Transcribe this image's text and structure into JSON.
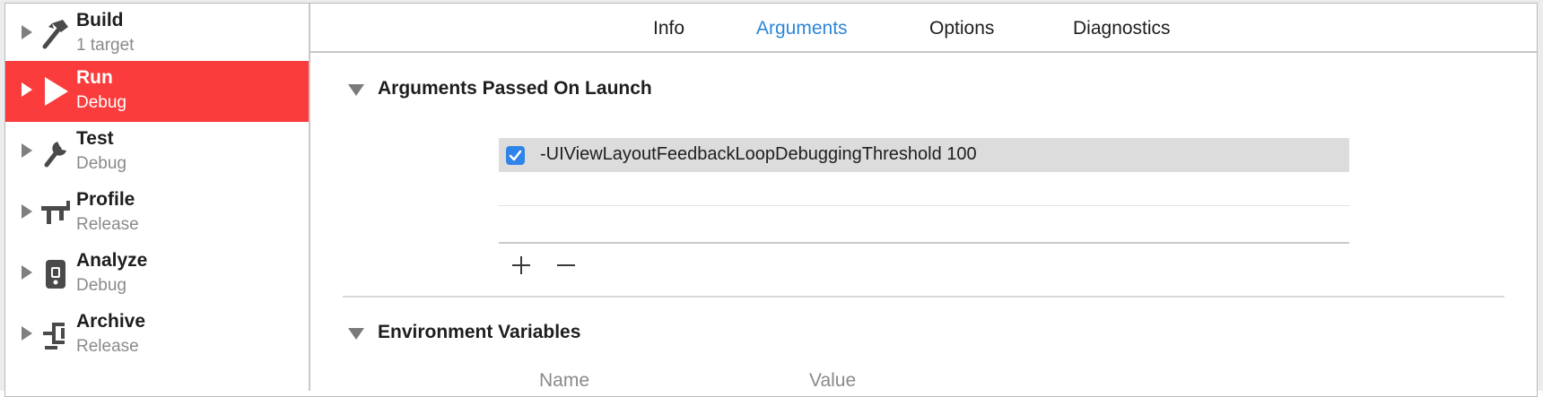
{
  "sidebar": {
    "items": [
      {
        "title": "Build",
        "subtitle": "1 target",
        "icon": "hammer-icon",
        "selected": false
      },
      {
        "title": "Run",
        "subtitle": "Debug",
        "icon": "play-icon",
        "selected": true
      },
      {
        "title": "Test",
        "subtitle": "Debug",
        "icon": "wrench-icon",
        "selected": false
      },
      {
        "title": "Profile",
        "subtitle": "Release",
        "icon": "caliper-icon",
        "selected": false
      },
      {
        "title": "Analyze",
        "subtitle": "Debug",
        "icon": "analyze-icon",
        "selected": false
      },
      {
        "title": "Archive",
        "subtitle": "Release",
        "icon": "clamp-icon",
        "selected": false
      }
    ]
  },
  "tabs": {
    "items": [
      {
        "label": "Info",
        "active": false
      },
      {
        "label": "Arguments",
        "active": true
      },
      {
        "label": "Options",
        "active": false
      },
      {
        "label": "Diagnostics",
        "active": false
      }
    ]
  },
  "arguments": {
    "section_title": "Arguments Passed On Launch",
    "rows": [
      {
        "text": "-UIViewLayoutFeedbackLoopDebuggingThreshold 100",
        "checked": true
      }
    ],
    "add_label": "+",
    "remove_label": "−"
  },
  "environment": {
    "section_title": "Environment Variables",
    "columns": [
      "Name",
      "Value"
    ]
  },
  "colors": {
    "selection": "#fa3c3c",
    "active_tab": "#2d86d6",
    "checkbox": "#2f84e9"
  }
}
